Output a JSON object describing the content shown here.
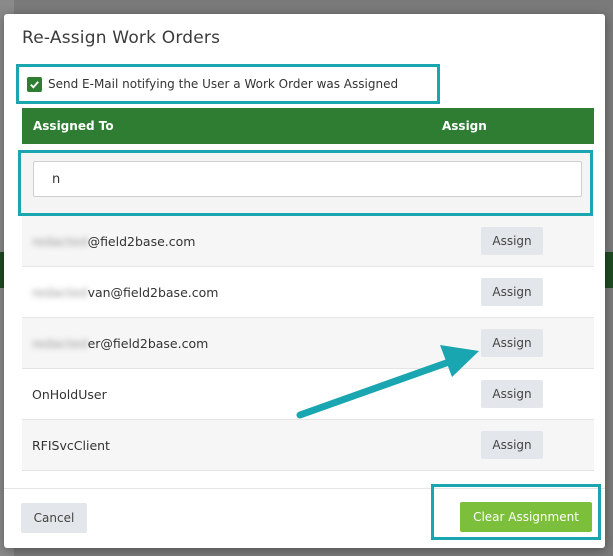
{
  "modal": {
    "title": "Re-Assign Work Orders",
    "notify_label": "Send E-Mail notifying the User a Work Order was Assigned",
    "notify_checked": true
  },
  "table": {
    "headers": {
      "assigned_to": "Assigned To",
      "assign": "Assign"
    },
    "search_value": "n",
    "rows": [
      {
        "user_hidden": "redacted",
        "user_visible": "@field2base.com",
        "assign_label": "Assign"
      },
      {
        "user_hidden": "redacted",
        "user_visible": "van@field2base.com",
        "assign_label": "Assign"
      },
      {
        "user_hidden": "redacted",
        "user_visible": "er@field2base.com",
        "assign_label": "Assign"
      },
      {
        "user_hidden": "",
        "user_visible": "OnHoldUser",
        "assign_label": "Assign"
      },
      {
        "user_hidden": "",
        "user_visible": "RFISvcClient",
        "assign_label": "Assign"
      }
    ]
  },
  "footer": {
    "cancel_label": "Cancel",
    "clear_label": "Clear Assignment"
  },
  "colors": {
    "header_green": "#2e7d32",
    "clear_green": "#7cbf3a",
    "highlight_teal": "#1aa6b0"
  }
}
